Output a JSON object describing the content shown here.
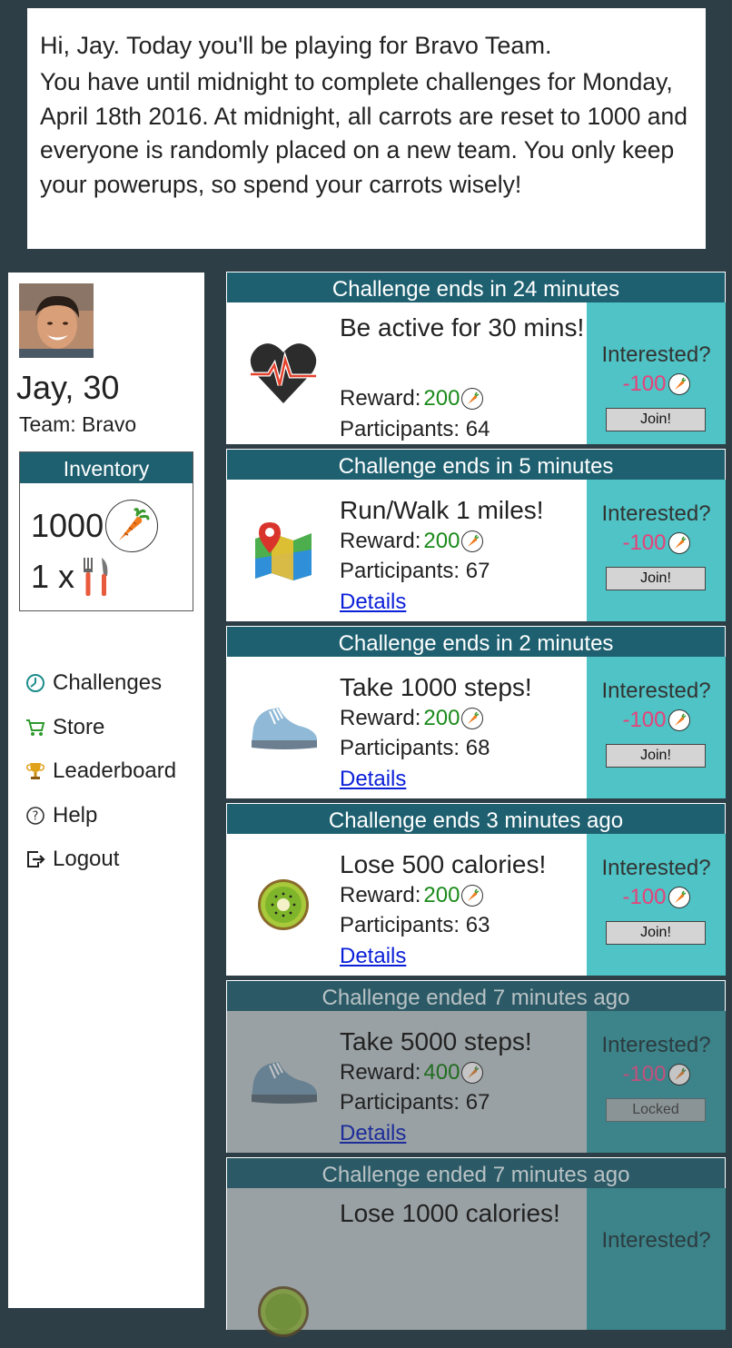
{
  "banner": {
    "greeting": "Hi, Jay. Today you'll be playing for Bravo Team.",
    "message": "You have until midnight to complete challenges for Monday, April 18th 2016. At midnight, all carrots are reset to 1000 and everyone is randomly placed on a new team. You only keep your powerups, so spend your carrots wisely!"
  },
  "user": {
    "name_age": "Jay, 30",
    "team": "Team: Bravo"
  },
  "inventory": {
    "title": "Inventory",
    "carrots": "1000",
    "powerup": "1 x"
  },
  "nav": {
    "challenges": "Challenges",
    "store": "Store",
    "leaderboard": "Leaderboard",
    "help": "Help",
    "logout": "Logout"
  },
  "labels": {
    "reward": "Reward:",
    "interested": "Interested?",
    "details": "Details"
  },
  "challenges": [
    {
      "header": "Challenge ends in 24 minutes",
      "title": "Be active for 30 mins!",
      "reward": "200",
      "participants": "Participants: 64",
      "cost": "-100",
      "button": "Join!",
      "icon": "heart-rate-icon",
      "status": "active"
    },
    {
      "header": "Challenge ends in 5 minutes",
      "title": "Run/Walk 1 miles!",
      "reward": "200",
      "participants": "Participants: 67",
      "cost": "-100",
      "button": "Join!",
      "icon": "map-icon",
      "status": "active"
    },
    {
      "header": "Challenge ends in 2 minutes",
      "title": "Take 1000 steps!",
      "reward": "200",
      "participants": "Participants: 68",
      "cost": "-100",
      "button": "Join!",
      "icon": "sneaker-icon",
      "status": "active"
    },
    {
      "header": "Challenge ends 3 minutes ago",
      "title": "Lose 500 calories!",
      "reward": "200",
      "participants": "Participants: 63",
      "cost": "-100",
      "button": "Join!",
      "icon": "kiwi-icon",
      "status": "active"
    },
    {
      "header": "Challenge ended 7 minutes ago",
      "title": "Take 5000 steps!",
      "reward": "400",
      "participants": "Participants: 67",
      "cost": "-100",
      "button": "Locked",
      "icon": "sneaker-icon",
      "status": "ended"
    },
    {
      "header": "Challenge ended 7 minutes ago",
      "title": "Lose 1000 calories!",
      "reward": "",
      "participants": "",
      "cost": "",
      "button": "",
      "icon": "kiwi-icon",
      "status": "ended"
    }
  ],
  "colors": {
    "page_bg": "#2d3e46",
    "header_teal": "#1e6070",
    "side_teal": "#4fc3c5",
    "reward_green": "#1a8a1a",
    "cost_pink": "#e8417a",
    "link_blue": "#0a1fd8"
  }
}
